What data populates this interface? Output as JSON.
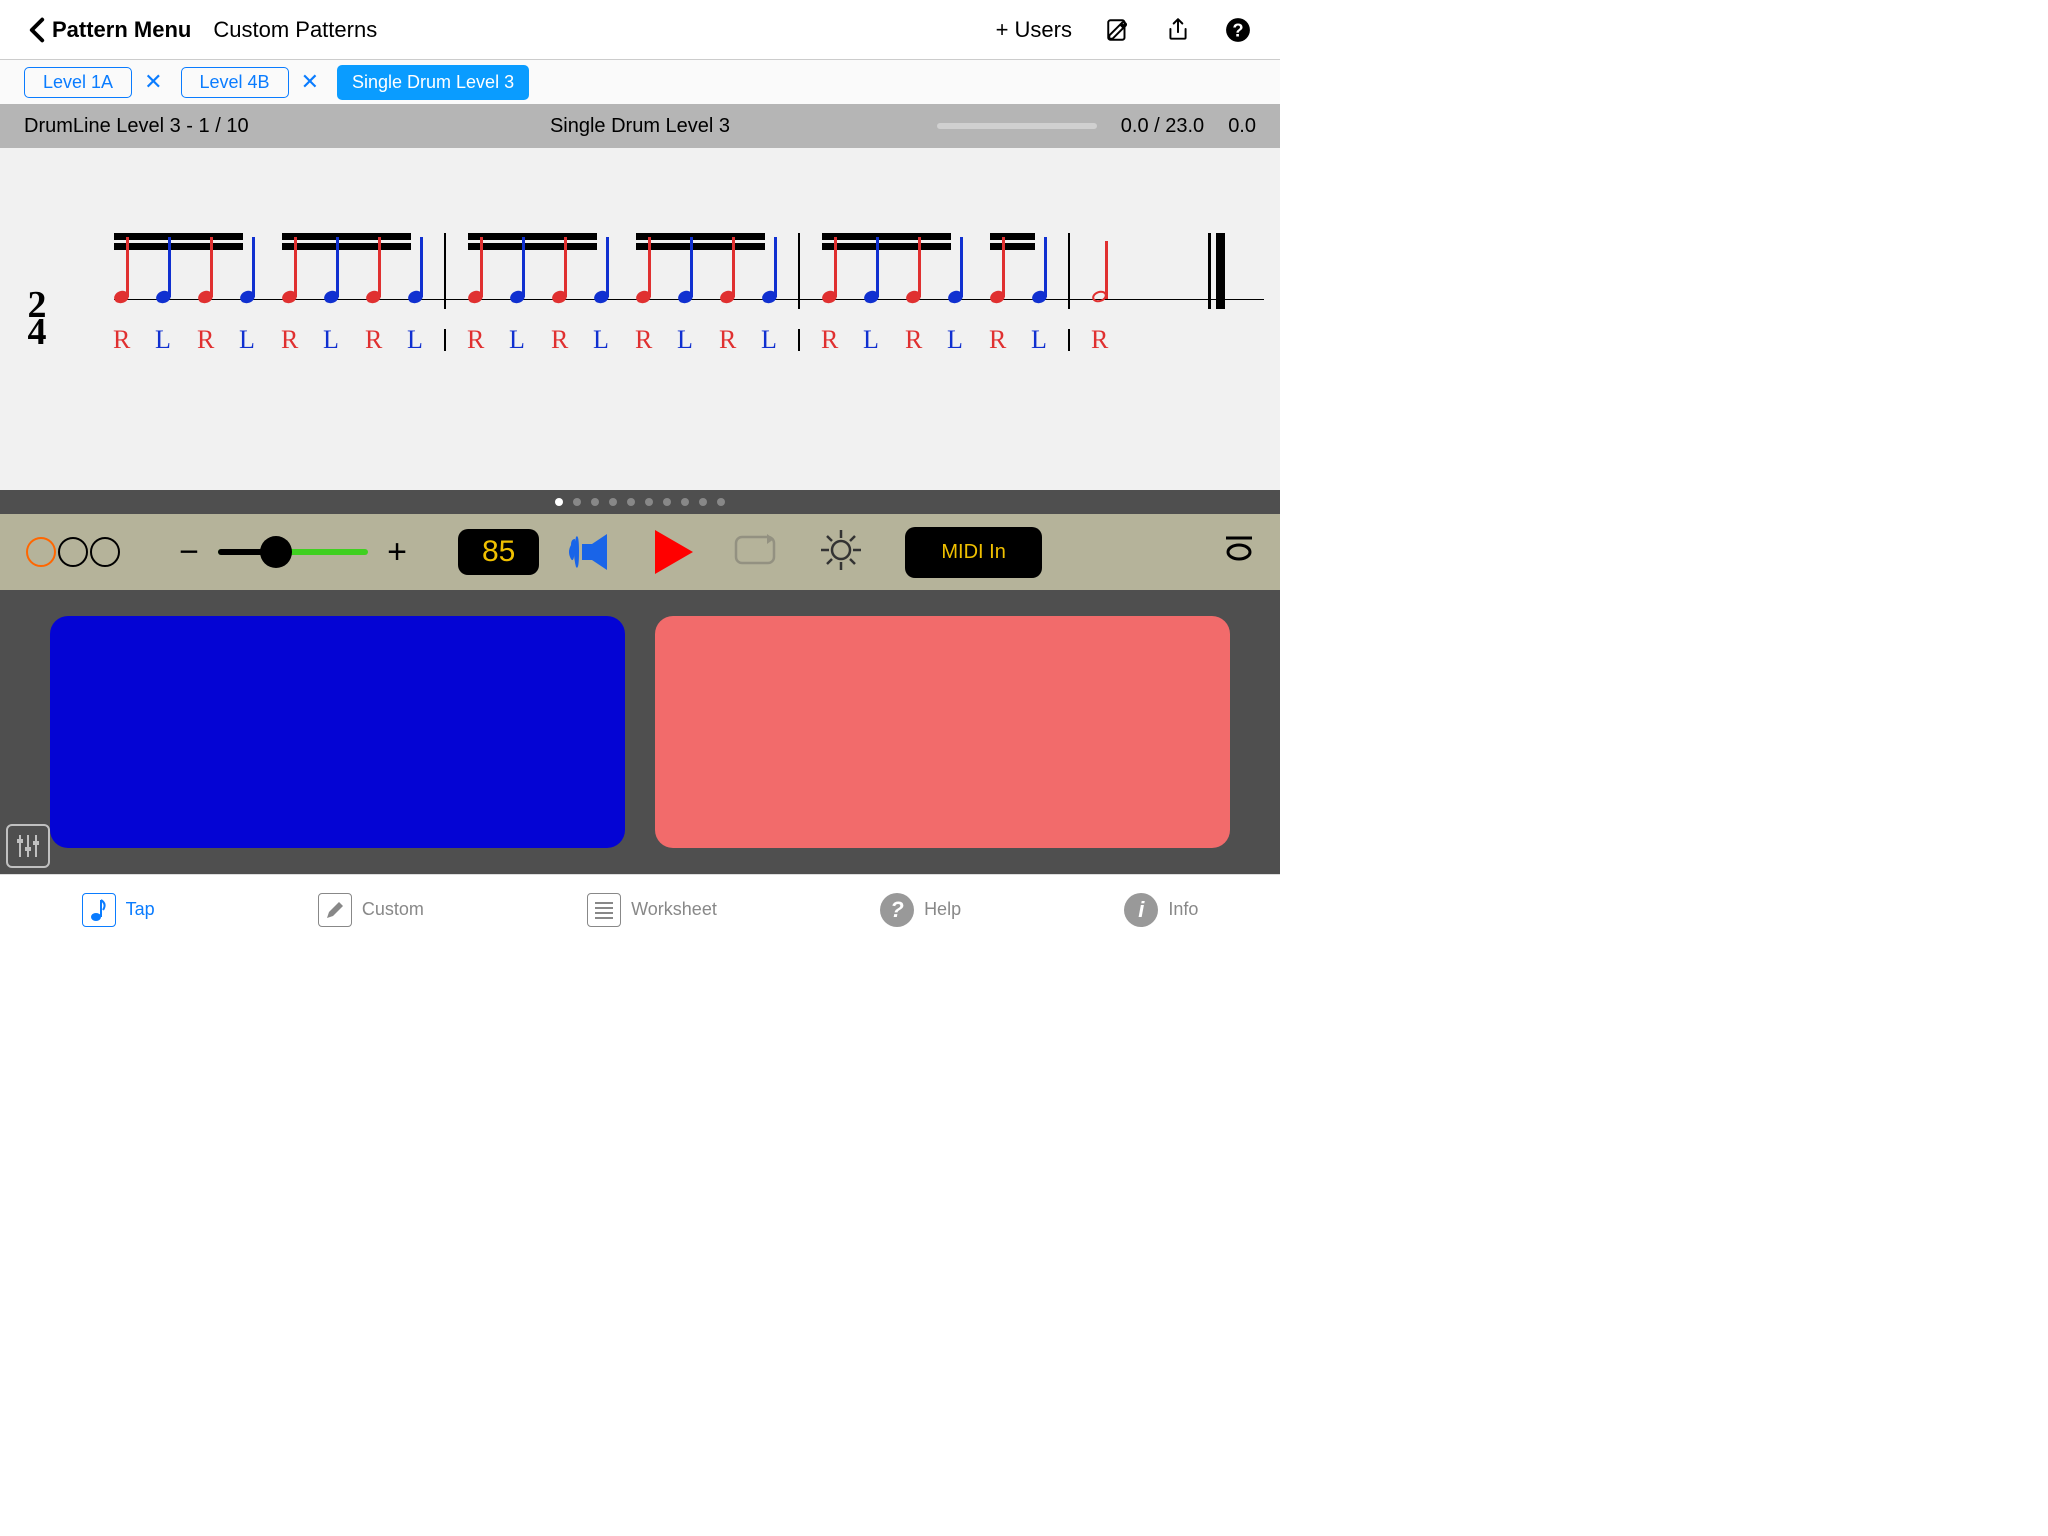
{
  "topbar": {
    "back_label": "Pattern Menu",
    "title": "Custom Patterns",
    "users_label": "+ Users"
  },
  "tabs": [
    {
      "label": "Level 1A",
      "closable": true,
      "active": false
    },
    {
      "label": "Level 4B",
      "closable": true,
      "active": false
    },
    {
      "label": "Single Drum Level 3",
      "closable": false,
      "active": true
    }
  ],
  "status": {
    "left": "DrumLine Level 3 - 1 / 10",
    "center": "Single Drum Level 3",
    "ratio": "0.0 / 23.0",
    "value": "0.0"
  },
  "notation": {
    "time_signature_top": "2",
    "time_signature_bottom": "4",
    "sticking": [
      "R",
      "L",
      "R",
      "L",
      "R",
      "L",
      "R",
      "L",
      "R",
      "L",
      "R",
      "L",
      "R",
      "L",
      "R",
      "L",
      "R",
      "L",
      "R",
      "L",
      "R",
      "L",
      "R"
    ],
    "note_kind": [
      "16",
      "16",
      "16",
      "16",
      "16",
      "16",
      "16",
      "16",
      "16",
      "16",
      "16",
      "16",
      "16",
      "16",
      "16",
      "16",
      "16",
      "16",
      "16",
      "16",
      "16",
      "16",
      "half"
    ],
    "note_color": [
      "red",
      "blue",
      "red",
      "blue",
      "red",
      "blue",
      "red",
      "blue",
      "red",
      "blue",
      "red",
      "blue",
      "red",
      "blue",
      "red",
      "blue",
      "red",
      "blue",
      "red",
      "blue",
      "red",
      "blue",
      "red"
    ],
    "barlines_after_index": [
      7,
      15,
      21,
      22
    ]
  },
  "controls": {
    "tempo": "85",
    "midi_label": "MIDI In",
    "page_dot_count": 10,
    "page_dot_active": 0
  },
  "bottombar": {
    "items": [
      {
        "label": "Tap",
        "active": true,
        "icon": "note-icon"
      },
      {
        "label": "Custom",
        "active": false,
        "icon": "pencil-icon"
      },
      {
        "label": "Worksheet",
        "active": false,
        "icon": "lines-icon"
      },
      {
        "label": "Help",
        "active": false,
        "icon": "question-circle-icon"
      },
      {
        "label": "Info",
        "active": false,
        "icon": "info-circle-icon"
      }
    ]
  },
  "colors": {
    "accent": "#0a7cff",
    "R": "#e03030",
    "L": "#1030d0",
    "pad_left": "#0404d4",
    "pad_right": "#f26b6b"
  }
}
